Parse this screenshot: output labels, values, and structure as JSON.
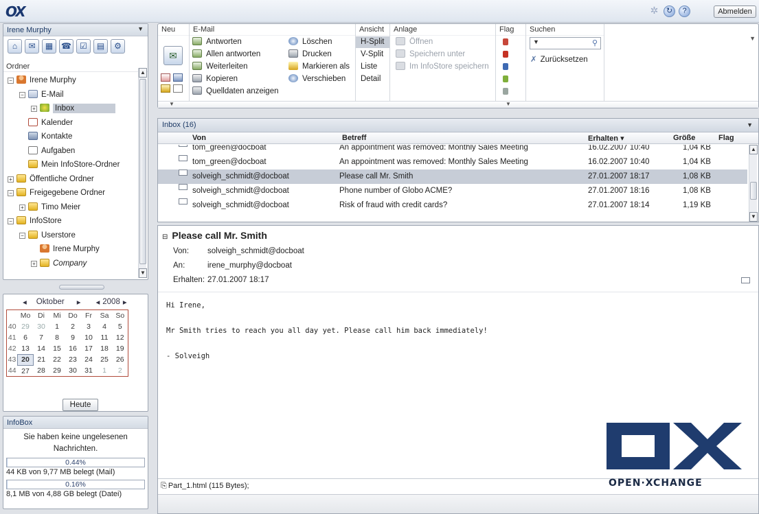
{
  "app": {
    "logo": "OX",
    "logout_label": "Abmelden"
  },
  "left": {
    "module_title": "Irene Murphy",
    "folder_label": "Ordner",
    "tree": [
      {
        "label": "Irene Murphy",
        "toggle": "⊟",
        "indent": 0,
        "icon": "user-icon"
      },
      {
        "label": "E-Mail",
        "toggle": "⊟",
        "indent": 1,
        "icon": "mail-icon"
      },
      {
        "label": "Inbox",
        "toggle": "⊞",
        "indent": 2,
        "icon": "inbox-icon",
        "selected": true
      },
      {
        "label": "Kalender",
        "toggle": "",
        "indent": 1,
        "icon": "calendar-icon"
      },
      {
        "label": "Kontakte",
        "toggle": "",
        "indent": 1,
        "icon": "contacts-icon"
      },
      {
        "label": "Aufgaben",
        "toggle": "",
        "indent": 1,
        "icon": "tasks-icon"
      },
      {
        "label": "Mein InfoStore-Ordner",
        "toggle": "",
        "indent": 1,
        "icon": "infostore-icon"
      },
      {
        "label": "Öffentliche Ordner",
        "toggle": "⊞",
        "indent": 0,
        "icon": "public-folder-icon"
      },
      {
        "label": "Freigegebene Ordner",
        "toggle": "⊟",
        "indent": 0,
        "icon": "shared-folder-icon"
      },
      {
        "label": "Timo Meier",
        "toggle": "⊞",
        "indent": 1,
        "icon": "folder-icon"
      },
      {
        "label": "InfoStore",
        "toggle": "⊟",
        "indent": 0,
        "icon": "folder-icon"
      },
      {
        "label": "Userstore",
        "toggle": "⊟",
        "indent": 1,
        "icon": "folder-icon"
      },
      {
        "label": "Irene Murphy",
        "toggle": "",
        "indent": 2,
        "icon": "user-icon"
      },
      {
        "label": "Company",
        "toggle": "⊞",
        "indent": 2,
        "icon": "folder-icon",
        "italic": true
      }
    ]
  },
  "calendar": {
    "month": "Oktober",
    "year": "2008",
    "prev_month": "◂",
    "next_month": "▸",
    "prev_year": "◂",
    "next_year": "▸",
    "weekdays": [
      "Mo",
      "Di",
      "Mi",
      "Do",
      "Fr",
      "Sa",
      "So"
    ],
    "weeks": [
      {
        "wk": "40",
        "days": [
          "29",
          "30",
          "1",
          "2",
          "3",
          "4",
          "5"
        ]
      },
      {
        "wk": "41",
        "days": [
          "6",
          "7",
          "8",
          "9",
          "10",
          "11",
          "12"
        ]
      },
      {
        "wk": "42",
        "days": [
          "13",
          "14",
          "15",
          "16",
          "17",
          "18",
          "19"
        ]
      },
      {
        "wk": "43",
        "days": [
          "20",
          "21",
          "22",
          "23",
          "24",
          "25",
          "26"
        ]
      },
      {
        "wk": "44",
        "days": [
          "27",
          "28",
          "29",
          "30",
          "31",
          "1",
          "2"
        ]
      }
    ],
    "today_day": "20",
    "today_label": "Heute"
  },
  "infobox": {
    "title": "InfoBox",
    "message": "Sie haben keine ungelesenen Nachrichten.",
    "mail_percent": "0.44%",
    "mail_fraction": 0.0044,
    "mail_usage": "44 KB von 9,77 MB belegt (Mail)",
    "file_percent": "0.16%",
    "file_fraction": 0.0016,
    "file_usage": "8,1 MB von 4,88 GB belegt (Datei)"
  },
  "ribbon": {
    "groups": {
      "neu": "Neu",
      "email": "E-Mail",
      "ansicht": "Ansicht",
      "anlage": "Anlage",
      "flag": "Flag",
      "suchen": "Suchen"
    },
    "email_actions": [
      "Antworten",
      "Allen antworten",
      "Weiterleiten",
      "Kopieren",
      "Quelldaten anzeigen"
    ],
    "email_actions2": [
      "Löschen",
      "Drucken",
      "Markieren als",
      "Verschieben"
    ],
    "views": [
      "H-Split",
      "V-Split",
      "Liste",
      "Detail"
    ],
    "attachment_actions": [
      "Öffnen",
      "Speichern unter",
      "Im InfoStore speichern"
    ],
    "reset_label": "Zurücksetzen"
  },
  "maillist": {
    "title": "Inbox (16)",
    "columns": {
      "from": "Von",
      "subject": "Betreff",
      "received": "Erhalten ▾",
      "size": "Größe",
      "flag": "Flag"
    },
    "rows": [
      {
        "from": "tom_green@docboat",
        "subject": "An appointment was removed: Monthly Sales Meeting",
        "received": "16.02.2007 10:40",
        "size": "1,04 KB"
      },
      {
        "from": "tom_green@docboat",
        "subject": "An appointment was removed: Monthly Sales Meeting",
        "received": "16.02.2007 10:40",
        "size": "1,04 KB"
      },
      {
        "from": "solveigh_schmidt@docboat",
        "subject": "Please call Mr. Smith",
        "received": "27.01.2007 18:17",
        "size": "1,08 KB",
        "selected": true
      },
      {
        "from": "solveigh_schmidt@docboat",
        "subject": "Phone number of Globo ACME?",
        "received": "27.01.2007 18:16",
        "size": "1,08 KB"
      },
      {
        "from": "solveigh_schmidt@docboat",
        "subject": "Risk of fraud with credit cards?",
        "received": "27.01.2007 18:14",
        "size": "1,19 KB"
      }
    ]
  },
  "reader": {
    "subject": "Please call Mr. Smith",
    "from_label": "Von:",
    "from": "solveigh_schmidt@docboat",
    "to_label": "An:",
    "to": "irene_murphy@docboat",
    "received_label": "Erhalten:",
    "received": "27.01.2007 18:17",
    "body": "Hi Irene,\n\nMr Smith tries to reach you all day yet. Please call him back immediately!\n\n- Solveigh",
    "attachment": "Part_1.html (115 Bytes);"
  },
  "brand": {
    "wordmark": "OPEN·XCHANGE"
  }
}
